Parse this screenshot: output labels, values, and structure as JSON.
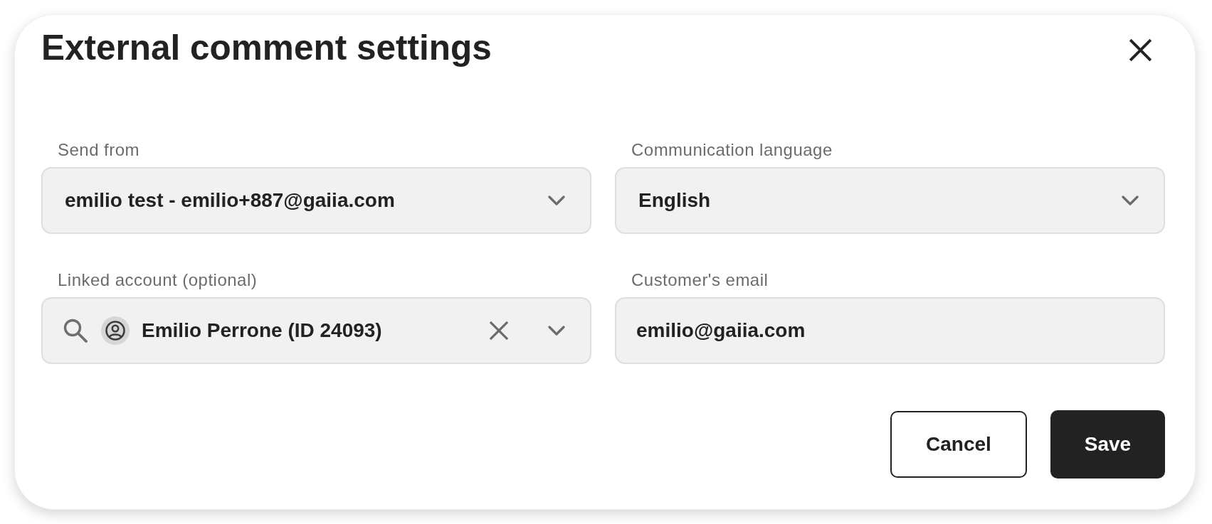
{
  "dialog": {
    "title": "External comment settings"
  },
  "fields": [
    {
      "kind": "select",
      "label": "Send from",
      "value": "emilio test - emilio+887@gaiia.com"
    },
    {
      "kind": "select",
      "label": "Communication language",
      "value": "English"
    },
    {
      "kind": "search_select",
      "label": "Linked account (optional)",
      "value": "Emilio Perrone (ID 24093)",
      "clearable": true
    },
    {
      "kind": "text",
      "label": "Customer's email",
      "value": "emilio@gaiia.com"
    }
  ],
  "buttons": [
    {
      "kind": "secondary",
      "label": "Cancel"
    },
    {
      "kind": "primary",
      "label": "Save"
    }
  ]
}
